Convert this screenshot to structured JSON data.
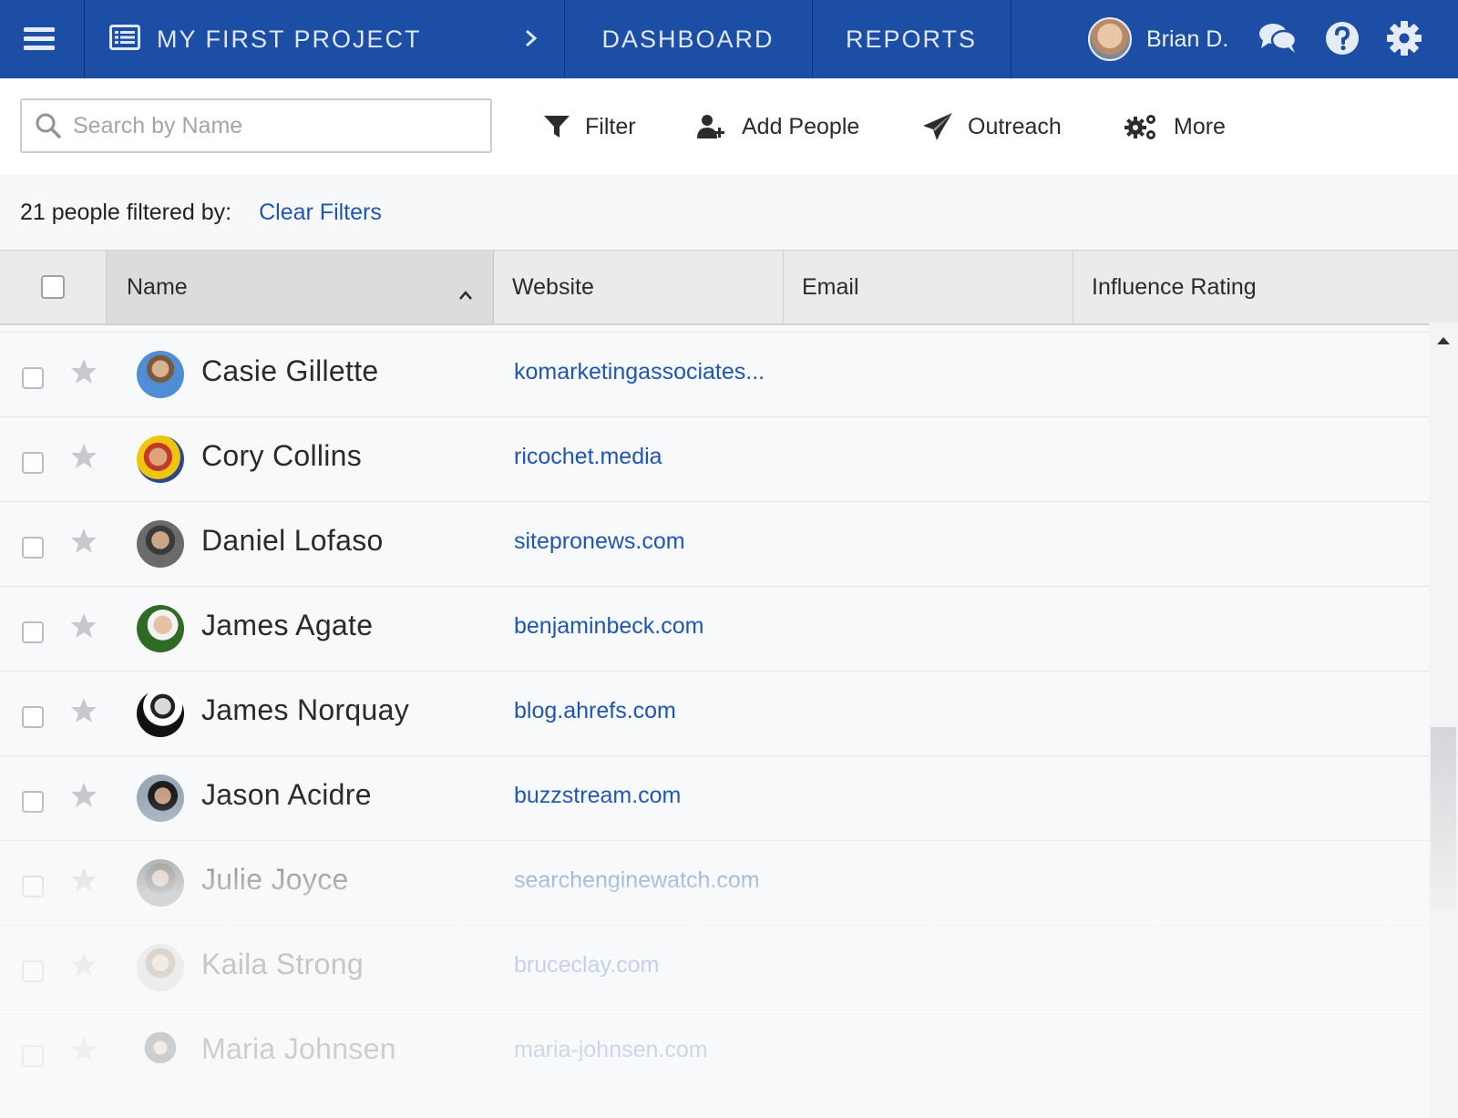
{
  "topbar": {
    "project_title": "MY FIRST PROJECT",
    "nav": {
      "dashboard": "DASHBOARD",
      "reports": "REPORTS"
    },
    "user_name": "Brian D.",
    "brand_color": "#1c4ea6"
  },
  "toolbar": {
    "search_placeholder": "Search by Name",
    "filter_label": "Filter",
    "add_people_label": "Add People",
    "outreach_label": "Outreach",
    "more_label": "More"
  },
  "filterbar": {
    "count_text": "21 people filtered by:",
    "clear_filters_label": "Clear Filters"
  },
  "table": {
    "columns": {
      "name": "Name",
      "website": "Website",
      "email": "Email",
      "influence": "Influence Rating"
    },
    "sort": {
      "column": "Name",
      "direction": "ascending"
    },
    "rows": [
      {
        "name": "Casie Gillette",
        "website": "komarketingassociates..."
      },
      {
        "name": "Cory Collins",
        "website": "ricochet.media"
      },
      {
        "name": "Daniel Lofaso",
        "website": "sitepronews.com"
      },
      {
        "name": "James Agate",
        "website": "benjaminbeck.com"
      },
      {
        "name": "James Norquay",
        "website": "blog.ahrefs.com"
      },
      {
        "name": "Jason Acidre",
        "website": "buzzstream.com"
      },
      {
        "name": "Julie Joyce",
        "website": "searchenginewatch.com"
      },
      {
        "name": "Kaila Strong",
        "website": "bruceclay.com"
      },
      {
        "name": "Maria Johnsen",
        "website": "maria-johnsen.com"
      }
    ]
  },
  "colors": {
    "link": "#1f56b3",
    "header_bg": "#ebebeb",
    "sorted_header_bg": "#dcdcdc"
  }
}
